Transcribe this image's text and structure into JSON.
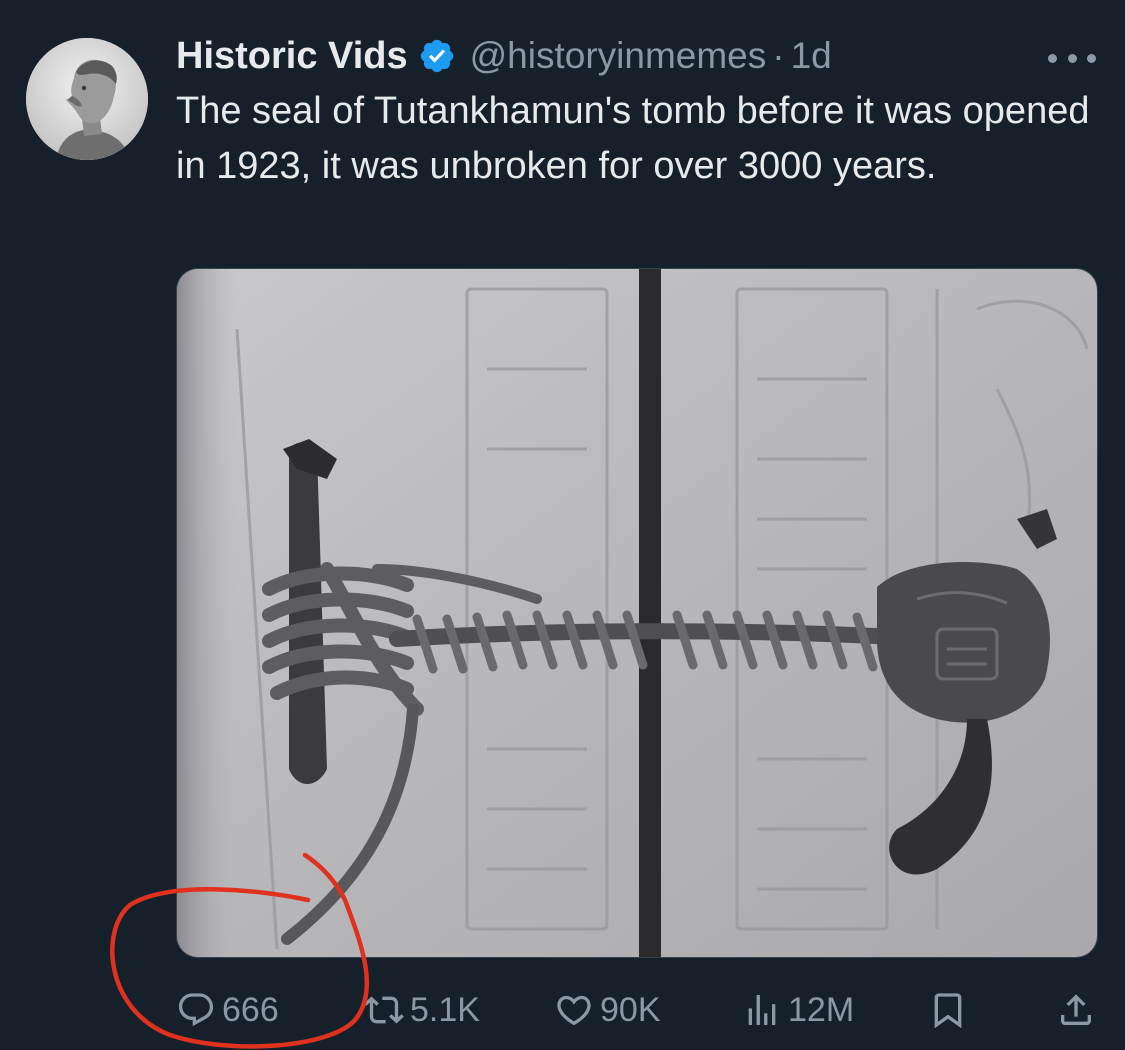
{
  "tweet": {
    "author": {
      "display_name": "Historic Vids",
      "handle": "@historyinmemes",
      "separator": "·",
      "time": "1d",
      "verified": true,
      "avatar_icon": "bust-portrait-avatar"
    },
    "text": "The seal of Tutankhamun's tomb before it was opened in 1923, it was unbroken for over 3000 years.",
    "media": {
      "kind": "photo",
      "subject_icon": "tomb-door-rope-seal-photo"
    },
    "actions": {
      "reply": {
        "icon": "reply-icon",
        "count": "666"
      },
      "retweet": {
        "icon": "retweet-icon",
        "count": "5.1K"
      },
      "like": {
        "icon": "heart-icon",
        "count": "90K"
      },
      "views": {
        "icon": "analytics-icon",
        "count": "12M"
      },
      "bookmark": {
        "icon": "bookmark-icon"
      },
      "share": {
        "icon": "share-icon"
      }
    }
  },
  "colors": {
    "background": "#15202b",
    "primary_text": "#e7e9ea",
    "secondary_text": "#8b98a5",
    "verified_badge": "#1d9bf0",
    "annotation": "#e0301e"
  }
}
